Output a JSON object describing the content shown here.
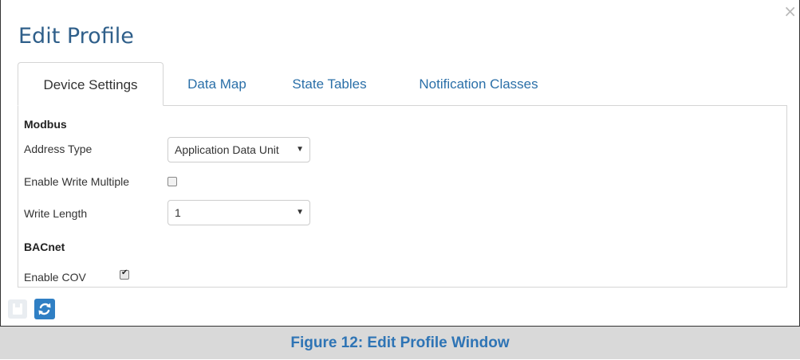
{
  "dialog": {
    "title": "Edit Profile",
    "close_glyph": "×"
  },
  "tabs": [
    {
      "label": "Device Settings",
      "active": true
    },
    {
      "label": "Data Map",
      "active": false
    },
    {
      "label": "State Tables",
      "active": false
    },
    {
      "label": "Notification Classes",
      "active": false
    }
  ],
  "modbus": {
    "section_title": "Modbus",
    "address_type": {
      "label": "Address Type",
      "value": "Application Data Unit"
    },
    "enable_write_multiple": {
      "label": "Enable Write Multiple",
      "checked": false
    },
    "write_length": {
      "label": "Write Length",
      "value": "1"
    }
  },
  "bacnet": {
    "section_title": "BACnet",
    "enable_cov": {
      "label": "Enable COV",
      "checked": true
    }
  },
  "toolbar": {
    "save_icon": "save-icon",
    "refresh_icon": "refresh-icon"
  },
  "caption": {
    "text": "Figure 12: Edit Profile Window"
  },
  "colors": {
    "title": "#2f5f8a",
    "tab_link": "#2a6fa8",
    "refresh_button": "#2f7fc4",
    "caption_text": "#2e74b5",
    "caption_bg": "#d9d9d9"
  }
}
